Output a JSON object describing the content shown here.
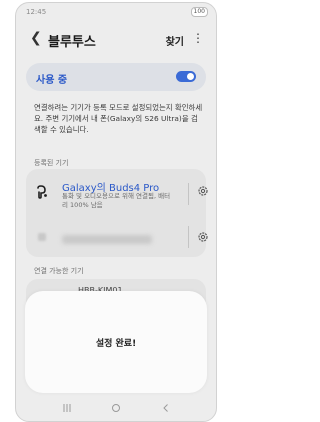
{
  "status_bar": {
    "time": "12:45",
    "battery": "100"
  },
  "header": {
    "title": "블루투스",
    "search_label": "찾기",
    "more_glyph": "⋮",
    "back_glyph": "❮"
  },
  "bluetooth_toggle": {
    "label": "사용 중",
    "state": "on"
  },
  "description": "연결하려는 기기가 등록 모드로 설정되었는지 확인하세요. 주변 기기에서 내 폰(Galaxy의 S26 Ultra)을 검색할 수 있습니다.",
  "registered": {
    "header": "등록된 기기",
    "devices": [
      {
        "name": "Galaxy의 Buds4 Pro",
        "status": "통화 및 오디오용으로 위해 연결됨, 배터리 100% 남음",
        "icon": "earbuds-icon"
      }
    ]
  },
  "available": {
    "header": "연결 가능한 기기",
    "first_item": "HBB-KIM01"
  },
  "sheet": {
    "message": "설정 완료!"
  },
  "accent_color": "#3a6ad6",
  "nav_icons": [
    "recents-icon",
    "home-icon",
    "back-icon"
  ]
}
